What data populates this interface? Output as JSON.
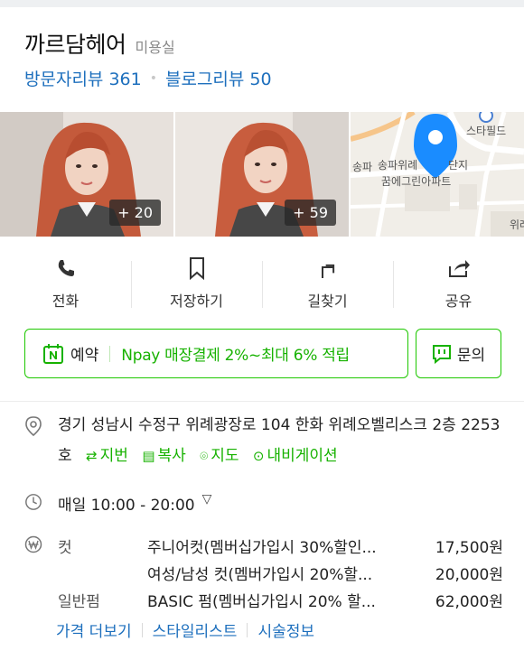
{
  "business": {
    "name": "까르담헤어",
    "category": "미용실",
    "visitor_reviews": "방문자리뷰 361",
    "blog_reviews": "블로그리뷰 50"
  },
  "photos": [
    {
      "count": "+ 20"
    },
    {
      "count": "+ 59"
    }
  ],
  "map": {
    "labels": [
      "스타필드",
      "송파",
      "송파위례",
      "단지",
      "꿈에그린아파트",
      "위례"
    ]
  },
  "actions": [
    {
      "label": "전화",
      "icon": "phone-icon"
    },
    {
      "label": "저장하기",
      "icon": "bookmark-icon"
    },
    {
      "label": "길찾기",
      "icon": "directions-icon"
    },
    {
      "label": "공유",
      "icon": "share-icon"
    }
  ],
  "booking": {
    "reserve_label": "예약",
    "npay_text": "Npay 매장결제 2%~최대 6% 적립",
    "inquiry_label": "문의"
  },
  "address": {
    "text": "경기 성남시 수정구 위례광장로 104 한화 위례오벨리스크 2층 2253호",
    "links": [
      {
        "label": "지번",
        "glyph": "⇄"
      },
      {
        "label": "복사",
        "glyph": "▤"
      },
      {
        "label": "지도",
        "glyph": "⌾"
      },
      {
        "label": "내비게이션",
        "glyph": "⊙"
      }
    ]
  },
  "hours": {
    "text": "매일 10:00 - 20:00"
  },
  "prices": [
    {
      "category": "컷",
      "name": "주니어컷(멤버십가입시 30%할인...",
      "amount": "17,500원"
    },
    {
      "category": "",
      "name": "여성/남성 컷(멤버가입시 20%할...",
      "amount": "20,000원"
    },
    {
      "category": "일반펌",
      "name": "BASIC 펌(멤버십가입시 20% 할...",
      "amount": "62,000원"
    }
  ],
  "more_links": [
    "가격 더보기",
    "스타일리스트",
    "시술정보"
  ],
  "colors": {
    "brand_green": "#1ec800",
    "link_blue": "#1d6fbd",
    "pin_blue": "#1a8cff"
  }
}
